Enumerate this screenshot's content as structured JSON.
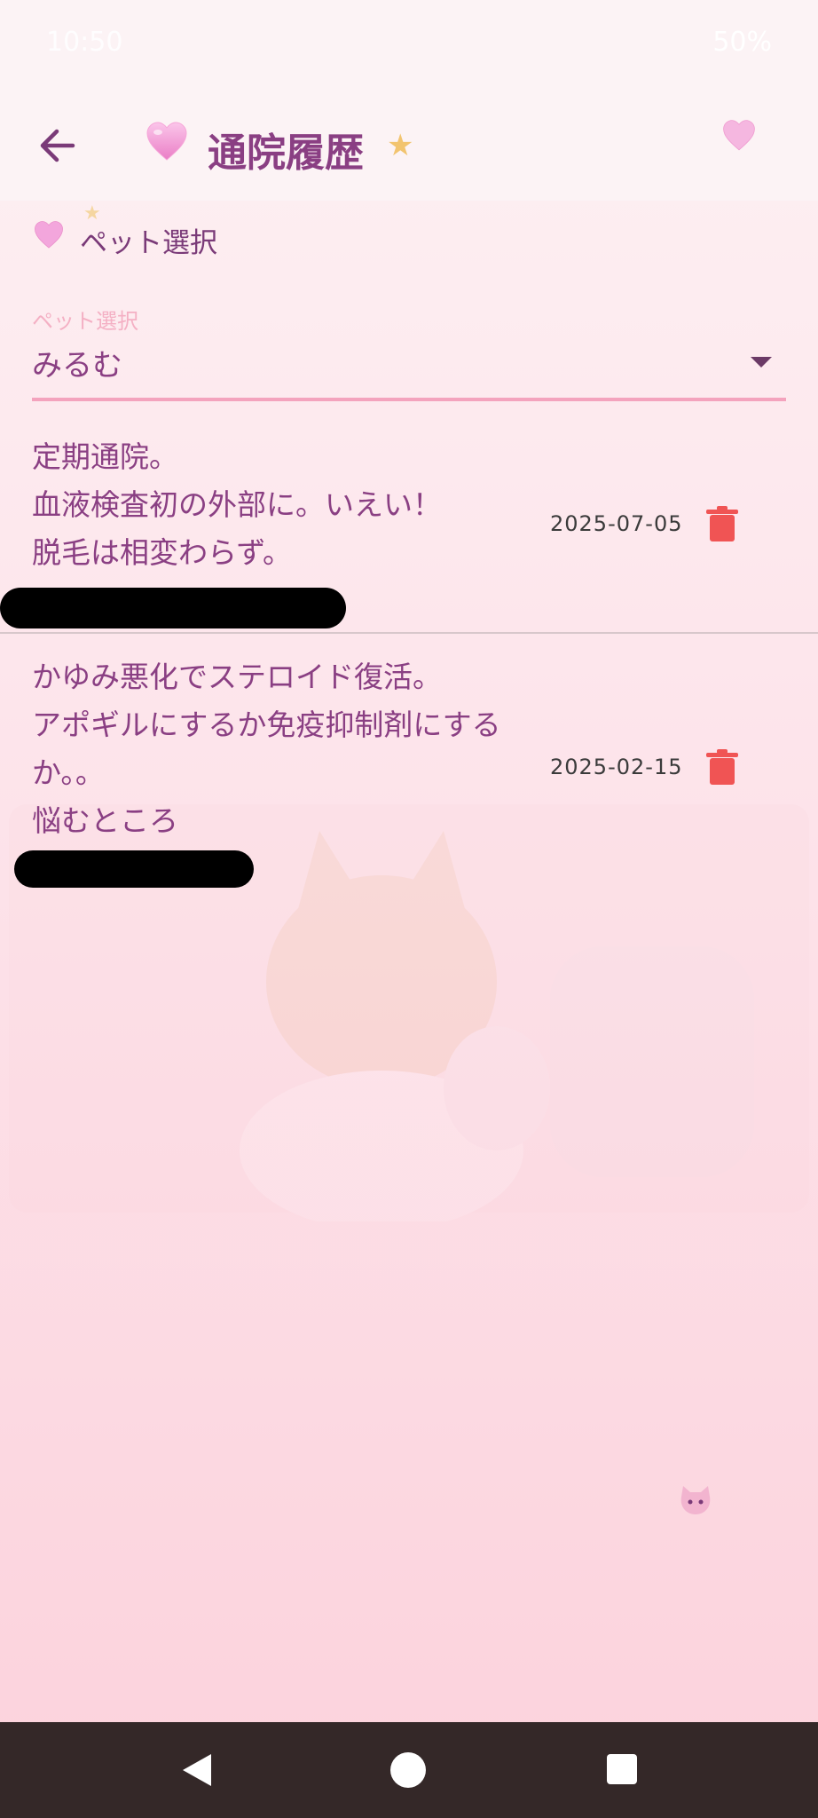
{
  "status_bar": {
    "time": "10:50",
    "battery": "50%"
  },
  "app_bar": {
    "title": "通院履歴"
  },
  "pet_section": {
    "header": "ペット選択",
    "select_label": "ペット選択",
    "selected_value": "みるむ"
  },
  "records": [
    {
      "text": "定期通院。\n血液検査初の外部に。いえい！\n脱毛は相変わらず。",
      "date": "2025-07-05"
    },
    {
      "text": "かゆみ悪化でステロイド復活。\nアポギルにするか免疫抑制剤にするか。。\n悩むところ",
      "date": "2025-02-15"
    }
  ],
  "colors": {
    "accent": "#8a3f83",
    "underline": "#f4a3bd",
    "delete": "#f05454",
    "nav_bar": "#342828"
  }
}
